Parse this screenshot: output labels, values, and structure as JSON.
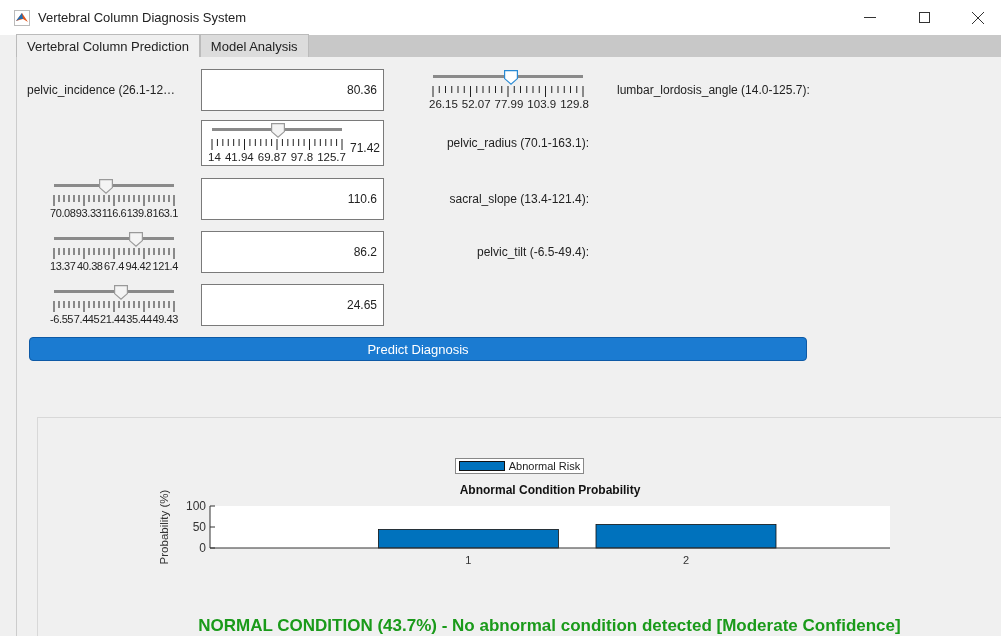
{
  "window": {
    "title": "Vertebral Column Diagnosis System"
  },
  "tabs": [
    {
      "label": "Vertebral Column Prediction",
      "selected": true
    },
    {
      "label": "Model Analysis",
      "selected": false
    }
  ],
  "rows": [
    {
      "left": {
        "kind": "label",
        "text": "pelvic_incidence (26.1-12…"
      },
      "field": {
        "kind": "input",
        "value": "80.36"
      },
      "right": [
        {
          "kind": "slider",
          "level": 0.523,
          "focused": true,
          "ticks": [
            "26.15",
            "52.07",
            "77.99",
            "103.9",
            "129.8"
          ]
        },
        {
          "kind": "label",
          "text": "lumbar_lordosis_angle (14.0-125.7):"
        }
      ]
    },
    {
      "left": {
        "kind": "none"
      },
      "field": {
        "kind": "slider_input",
        "value": "71.42",
        "slider": {
          "level": 0.51,
          "focused": false,
          "ticks": [
            "14",
            "41.94",
            "69.87",
            "97.8",
            "125.7"
          ]
        }
      },
      "right": [
        {
          "kind": "label",
          "text": "pelvic_radius (70.1-163.1):"
        }
      ]
    },
    {
      "left": {
        "kind": "slider",
        "level": 0.43,
        "focused": false,
        "ticks": [
          "70.08",
          "93.33",
          "116.6",
          "139.8",
          "163.1"
        ]
      },
      "field": {
        "kind": "input",
        "value": "110.6"
      },
      "right": [
        {
          "kind": "label",
          "text": "sacral_slope (13.4-121.4):"
        }
      ]
    },
    {
      "left": {
        "kind": "slider",
        "level": 0.68,
        "focused": false,
        "ticks": [
          "13.37",
          "40.38",
          "67.4",
          "94.42",
          "121.4"
        ]
      },
      "field": {
        "kind": "input",
        "value": "86.2"
      },
      "right": [
        {
          "kind": "label",
          "text": "pelvic_tilt (-6.5-49.4):"
        }
      ]
    },
    {
      "left": {
        "kind": "slider",
        "level": 0.56,
        "focused": false,
        "ticks": [
          "-6.55",
          "7.445",
          "21.44",
          "35.44",
          "49.43"
        ]
      },
      "field": {
        "kind": "input",
        "value": "24.65"
      },
      "right": []
    }
  ],
  "predict_button": "Predict Diagnosis",
  "results": {
    "chart_data": {
      "type": "bar",
      "title": "Abnormal Condition Probability",
      "ylabel": "Probability (%)",
      "categories": [
        "1",
        "2"
      ],
      "series": [
        {
          "name": "Abnormal Risk",
          "color": "#0072bd",
          "values": [
            44,
            56
          ]
        }
      ],
      "ylim": [
        0,
        100
      ],
      "yticks": [
        0,
        50,
        100
      ]
    },
    "message": "NORMAL CONDITION (43.7%) - No abnormal condition detected [Moderate Confidence]"
  }
}
